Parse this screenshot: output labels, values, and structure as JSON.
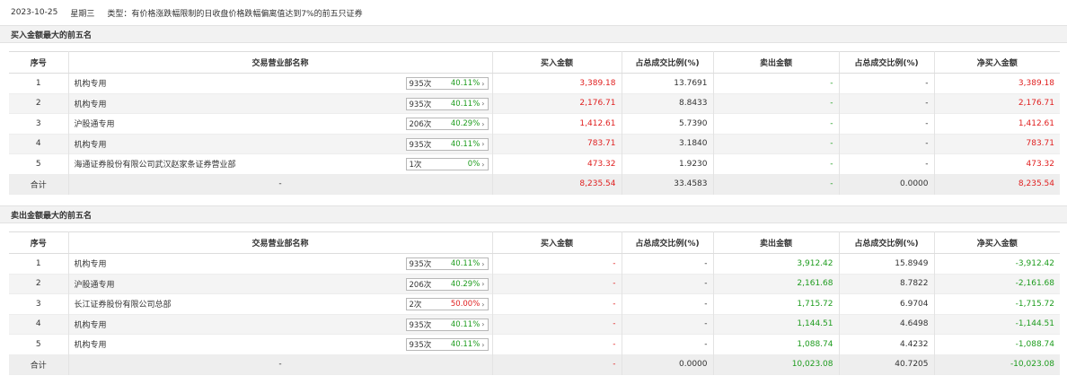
{
  "header": {
    "date": "2023-10-25",
    "weekday": "星期三",
    "type_text": "类型：有价格涨跌幅限制的日收盘价格跌幅偏离值达到7%的前五只证券"
  },
  "columns": {
    "seq": "序号",
    "dept": "交易营业部名称",
    "buy_amount": "买入金额",
    "buy_ratio": "占总成交比例(%)",
    "sell_amount": "卖出金额",
    "sell_ratio": "占总成交比例(%)",
    "net_buy": "净买入金额"
  },
  "buy_section": {
    "title": "买入金额最大的前五名",
    "rows": [
      {
        "seq": "1",
        "name": "机构专用",
        "count": "935次",
        "rate": "40.11%",
        "rate_color": "green",
        "buy_amount": "3,389.18",
        "buy_ratio": "13.7691",
        "sell_amount": "-",
        "sell_ratio": "-",
        "net_buy": "3,389.18"
      },
      {
        "seq": "2",
        "name": "机构专用",
        "count": "935次",
        "rate": "40.11%",
        "rate_color": "green",
        "buy_amount": "2,176.71",
        "buy_ratio": "8.8433",
        "sell_amount": "-",
        "sell_ratio": "-",
        "net_buy": "2,176.71"
      },
      {
        "seq": "3",
        "name": "沪股通专用",
        "count": "206次",
        "rate": "40.29%",
        "rate_color": "green",
        "buy_amount": "1,412.61",
        "buy_ratio": "5.7390",
        "sell_amount": "-",
        "sell_ratio": "-",
        "net_buy": "1,412.61"
      },
      {
        "seq": "4",
        "name": "机构专用",
        "count": "935次",
        "rate": "40.11%",
        "rate_color": "green",
        "buy_amount": "783.71",
        "buy_ratio": "3.1840",
        "sell_amount": "-",
        "sell_ratio": "-",
        "net_buy": "783.71"
      },
      {
        "seq": "5",
        "name": "海通证券股份有限公司武汉赵家条证券营业部",
        "count": "1次",
        "rate": "0%",
        "rate_color": "green",
        "buy_amount": "473.32",
        "buy_ratio": "1.9230",
        "sell_amount": "-",
        "sell_ratio": "-",
        "net_buy": "473.32"
      }
    ],
    "total": {
      "label": "合计",
      "name": "-",
      "buy_amount": "8,235.54",
      "buy_ratio": "33.4583",
      "sell_amount": "-",
      "sell_ratio": "0.0000",
      "net_buy": "8,235.54"
    }
  },
  "sell_section": {
    "title": "卖出金额最大的前五名",
    "rows": [
      {
        "seq": "1",
        "name": "机构专用",
        "count": "935次",
        "rate": "40.11%",
        "rate_color": "green",
        "buy_amount": "-",
        "buy_ratio": "-",
        "sell_amount": "3,912.42",
        "sell_ratio": "15.8949",
        "net_buy": "-3,912.42"
      },
      {
        "seq": "2",
        "name": "沪股通专用",
        "count": "206次",
        "rate": "40.29%",
        "rate_color": "green",
        "buy_amount": "-",
        "buy_ratio": "-",
        "sell_amount": "2,161.68",
        "sell_ratio": "8.7822",
        "net_buy": "-2,161.68"
      },
      {
        "seq": "3",
        "name": "长江证券股份有限公司总部",
        "count": "2次",
        "rate": "50.00%",
        "rate_color": "red",
        "buy_amount": "-",
        "buy_ratio": "-",
        "sell_amount": "1,715.72",
        "sell_ratio": "6.9704",
        "net_buy": "-1,715.72"
      },
      {
        "seq": "4",
        "name": "机构专用",
        "count": "935次",
        "rate": "40.11%",
        "rate_color": "green",
        "buy_amount": "-",
        "buy_ratio": "-",
        "sell_amount": "1,144.51",
        "sell_ratio": "4.6498",
        "net_buy": "-1,144.51"
      },
      {
        "seq": "5",
        "name": "机构专用",
        "count": "935次",
        "rate": "40.11%",
        "rate_color": "green",
        "buy_amount": "-",
        "buy_ratio": "-",
        "sell_amount": "1,088.74",
        "sell_ratio": "4.4232",
        "net_buy": "-1,088.74"
      }
    ],
    "total": {
      "label": "合计",
      "name": "-",
      "buy_amount": "-",
      "buy_ratio": "0.0000",
      "sell_amount": "10,023.08",
      "sell_ratio": "40.7205",
      "net_buy": "-10,023.08"
    }
  },
  "colors": {
    "up": "#e02020",
    "down": "#1e9c1e",
    "text": "#333333",
    "row_alt": "#f4f4f4",
    "section_bg": "#f2f2f2"
  },
  "icons": {
    "detail_arrow": "chevron-right-icon"
  }
}
